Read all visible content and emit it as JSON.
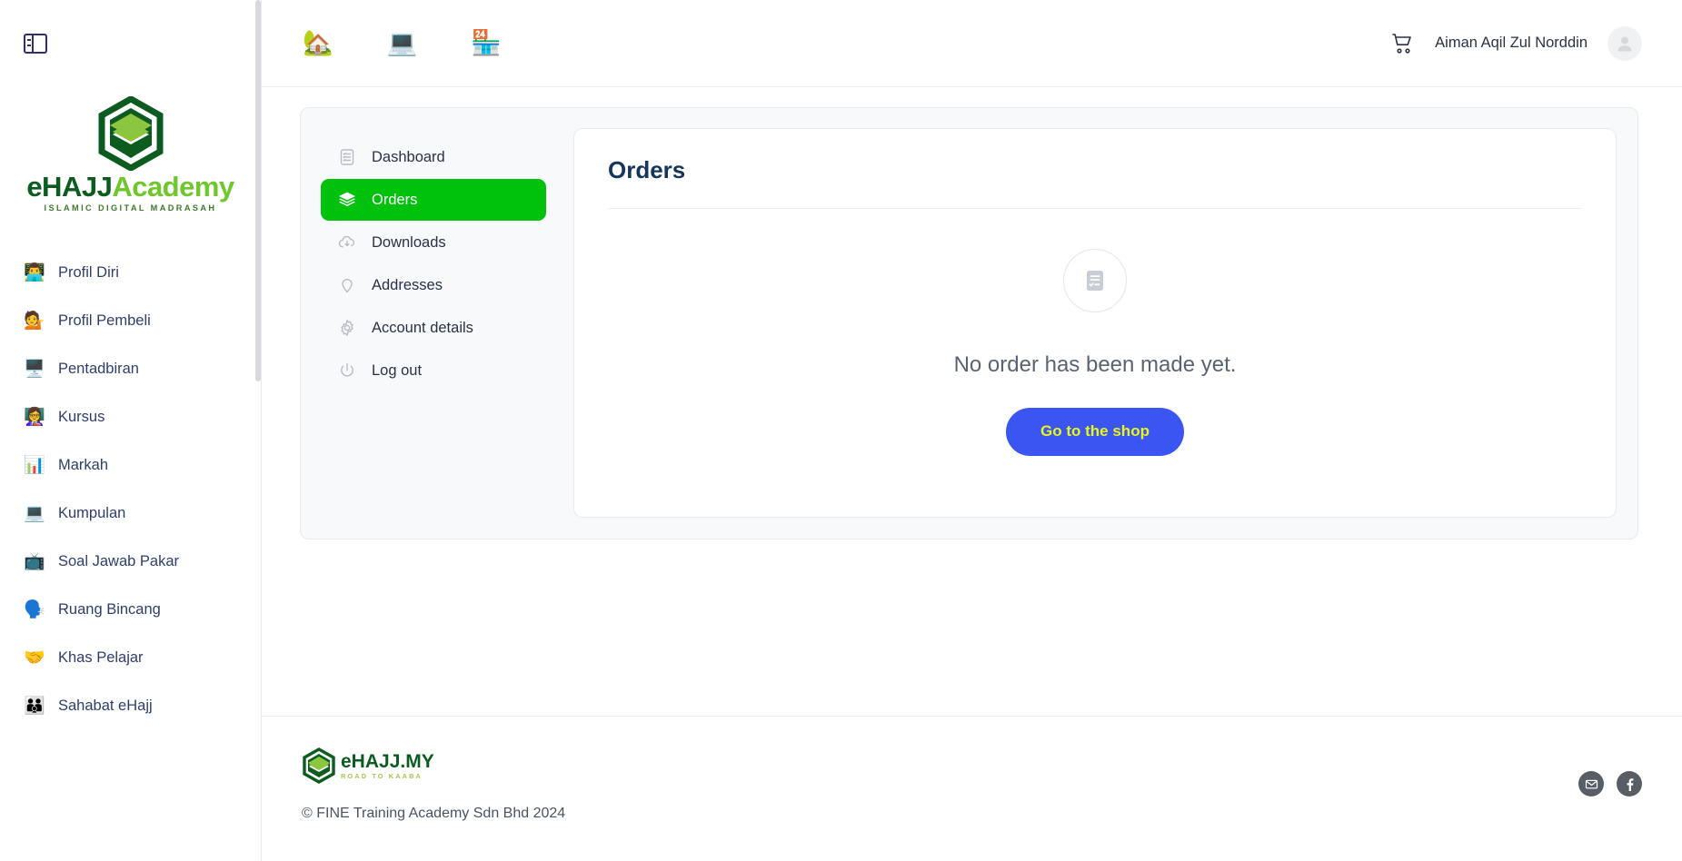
{
  "sidebar": {
    "toggle_icon": "panel-toggle-icon",
    "brand": {
      "logo_icon": "ehajj-kaaba-logo",
      "name_part1": "eHAJJ",
      "name_part2": "Academy",
      "tagline": "ISLAMIC DIGITAL MADRASAH"
    },
    "items": [
      {
        "label": "Profil Diri",
        "emoji": "👨‍💻",
        "icon": "profile-self-icon"
      },
      {
        "label": "Profil Pembeli",
        "emoji": "💁",
        "icon": "profile-buyer-icon"
      },
      {
        "label": "Pentadbiran",
        "emoji": "🖥️",
        "icon": "administration-icon"
      },
      {
        "label": "Kursus",
        "emoji": "👩‍🏫",
        "icon": "courses-icon"
      },
      {
        "label": "Markah",
        "emoji": "📊",
        "icon": "scores-icon"
      },
      {
        "label": "Kumpulan",
        "emoji": "💻",
        "icon": "groups-icon"
      },
      {
        "label": "Soal Jawab Pakar",
        "emoji": "📺",
        "icon": "expert-qa-icon"
      },
      {
        "label": "Ruang Bincang",
        "emoji": "🗣️",
        "icon": "discussion-room-icon"
      },
      {
        "label": "Khas Pelajar",
        "emoji": "🤝",
        "icon": "student-special-icon"
      },
      {
        "label": "Sahabat eHajj",
        "emoji": "👪",
        "icon": "ehajj-friends-icon"
      }
    ]
  },
  "topbar": {
    "icons": [
      {
        "name": "home-icon",
        "emoji": "🏡",
        "title": "Home"
      },
      {
        "name": "learn-icon",
        "emoji": "💻",
        "title": "Learning"
      },
      {
        "name": "shop-icon",
        "emoji": "🏪",
        "title": "Shop"
      }
    ],
    "cart_icon": "shopping-cart-icon",
    "user_name": "Aiman Aqil Zul Norddin",
    "avatar_icon": "user-avatar-icon"
  },
  "account_nav": {
    "items": [
      {
        "label": "Dashboard",
        "icon": "document-list-icon",
        "active": false
      },
      {
        "label": "Orders",
        "icon": "layers-icon",
        "active": true
      },
      {
        "label": "Downloads",
        "icon": "cloud-download-icon",
        "active": false
      },
      {
        "label": "Addresses",
        "icon": "map-pin-icon",
        "active": false
      },
      {
        "label": "Account details",
        "icon": "gear-icon",
        "active": false
      },
      {
        "label": "Log out",
        "icon": "power-icon",
        "active": false
      }
    ],
    "active_color": "#00c20d"
  },
  "main": {
    "title": "Orders",
    "empty_icon": "empty-order-document-icon",
    "empty_message": "No order has been made yet.",
    "cta_label": "Go to the shop",
    "cta_bg": "#3b55f2",
    "cta_text_color": "#e8f717"
  },
  "footer": {
    "logo": {
      "icon": "ehajj-my-logo",
      "name": "eHAJJ.MY",
      "tagline": "ROAD TO KAABA"
    },
    "copyright": "© FINE Training Academy Sdn Bhd 2024",
    "socials": [
      {
        "name": "email-icon",
        "label": "Email"
      },
      {
        "name": "facebook-icon",
        "label": "Facebook"
      }
    ]
  }
}
